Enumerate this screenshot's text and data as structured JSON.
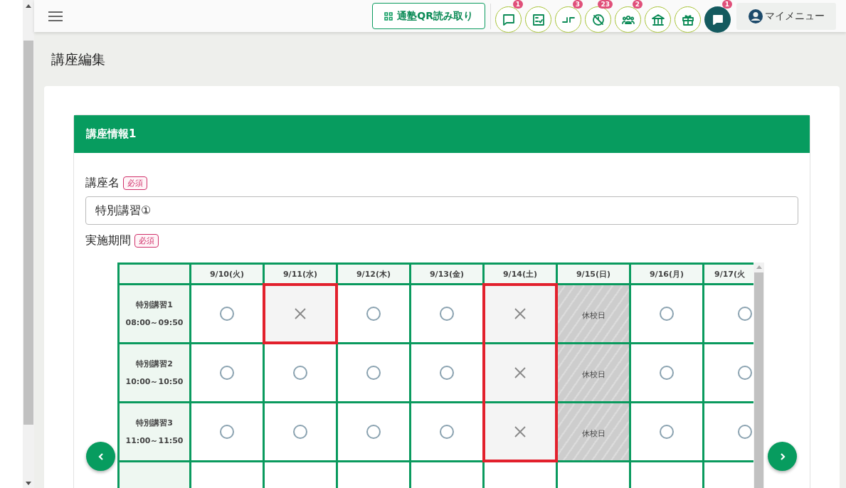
{
  "header": {
    "qr_button": "通塾QR読み取り",
    "icon_buttons": [
      {
        "kind": "outline",
        "badge": "1"
      },
      {
        "kind": "outline"
      },
      {
        "kind": "outline",
        "badge": "3"
      },
      {
        "kind": "outline",
        "badge": "23"
      },
      {
        "kind": "outline",
        "badge": "2"
      },
      {
        "kind": "outline"
      },
      {
        "kind": "outline"
      },
      {
        "kind": "filled",
        "badge": "1"
      }
    ],
    "my_menu": "マイメニュー"
  },
  "page_title": "講座編集",
  "section": {
    "title": "講座情報1",
    "fields": [
      {
        "label": "講座名",
        "required_tag": "必須",
        "value": "特別講習①"
      },
      {
        "label": "実施期間",
        "required_tag": "必須"
      }
    ]
  },
  "schedule": {
    "columns": [
      "9/10(火)",
      "9/11(水)",
      "9/12(木)",
      "9/13(金)",
      "9/14(土)",
      "9/15(日)",
      "9/16(月)",
      "9/17(火"
    ],
    "rows": [
      {
        "name": "特別講習1",
        "time": "08:00～09:50",
        "cells": [
          {
            "kind": "available",
            "highlighted": false
          },
          {
            "kind": "unavailable",
            "highlighted": true
          },
          {
            "kind": "available",
            "highlighted": false
          },
          {
            "kind": "available",
            "highlighted": false
          },
          {
            "kind": "unavailable",
            "highlighted": true
          },
          {
            "kind": "holiday",
            "text": "休校日",
            "highlighted": false
          },
          {
            "kind": "available",
            "highlighted": false
          },
          {
            "kind": "available",
            "highlighted": false
          }
        ]
      },
      {
        "name": "特別講習2",
        "time": "10:00～10:50",
        "cells": [
          {
            "kind": "available",
            "highlighted": false
          },
          {
            "kind": "available",
            "highlighted": false
          },
          {
            "kind": "available",
            "highlighted": false
          },
          {
            "kind": "available",
            "highlighted": false
          },
          {
            "kind": "unavailable",
            "highlighted": true
          },
          {
            "kind": "holiday",
            "text": "休校日",
            "highlighted": false
          },
          {
            "kind": "available",
            "highlighted": false
          },
          {
            "kind": "available",
            "highlighted": false
          }
        ]
      },
      {
        "name": "特別講習3",
        "time": "11:00～11:50",
        "cells": [
          {
            "kind": "available",
            "highlighted": false
          },
          {
            "kind": "available",
            "highlighted": false
          },
          {
            "kind": "available",
            "highlighted": false
          },
          {
            "kind": "available",
            "highlighted": false
          },
          {
            "kind": "unavailable",
            "highlighted": true
          },
          {
            "kind": "holiday",
            "text": "休校日",
            "highlighted": false
          },
          {
            "kind": "available",
            "highlighted": false
          },
          {
            "kind": "available",
            "highlighted": false
          }
        ]
      }
    ]
  }
}
